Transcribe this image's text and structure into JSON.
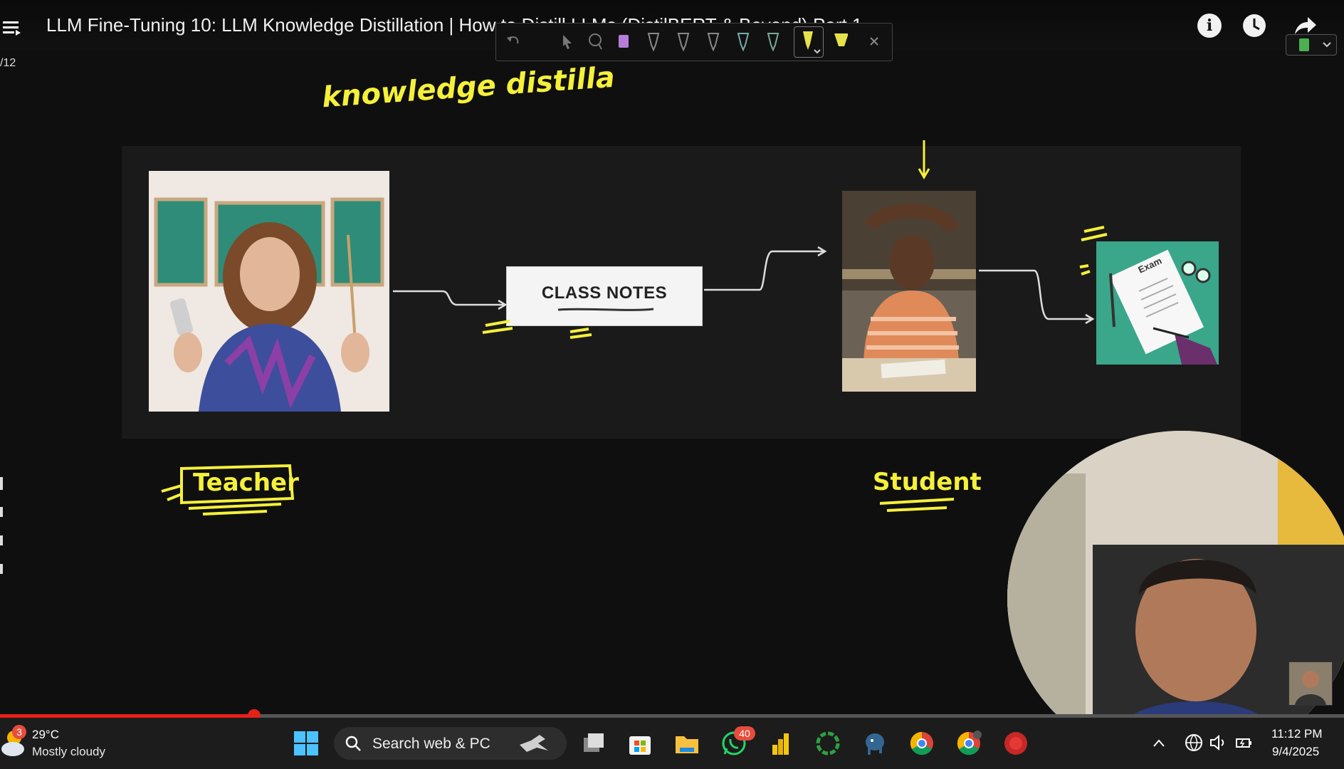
{
  "header": {
    "title": "LLM Fine-Tuning 10: LLM Knowledge Distillation | How to Distill LLMs (DistilBERT & Beyond) Part 1",
    "info_icon": "info-icon",
    "history_icon": "clock-icon",
    "share_icon": "share-icon",
    "page_indicator": "/12"
  },
  "pen_toolbar": {
    "tools": [
      "undo-icon",
      "select-icon",
      "lasso-icon",
      "highlighter-purple",
      "pen-1",
      "pen-2",
      "pen-3",
      "pen-4",
      "pen-5",
      "pen-yellow-active",
      "highlighter-yellow",
      "close-icon"
    ]
  },
  "slide": {
    "notes_label": "CLASS NOTES",
    "exam_label": "Exam"
  },
  "annotations": {
    "knowledge": "knowledge distilla",
    "teacher": "Teacher",
    "student": "Student"
  },
  "taskbar": {
    "weather_badge": "3",
    "temperature": "29°C",
    "condition": "Mostly cloudy",
    "search_placeholder": "Search web & PC",
    "whatsapp_badge": "40",
    "time": "11:12 PM",
    "date": "9/4/2025"
  },
  "colors": {
    "accent_red": "#e62117",
    "annotation_yellow": "#f5f03a",
    "exam_green": "#3aa68a"
  }
}
